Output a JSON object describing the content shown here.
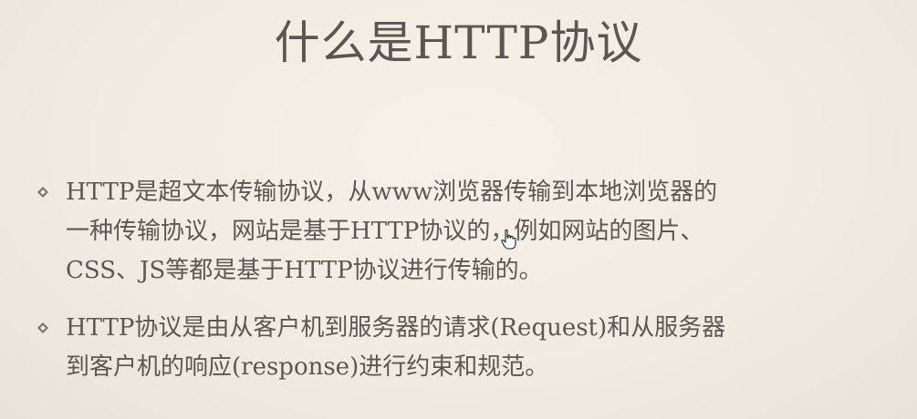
{
  "slide": {
    "title": "什么是HTTP协议",
    "bullets": [
      {
        "lines": [
          "HTTP是超文本传输协议，从www浏览器传输到本地浏览器的",
          "一种传输协议，网站是基于HTTP协议的，例如网站的图片、",
          "CSS、JS等都是基于HTTP协议进行传输的。"
        ],
        "marker_icon": "diamond-bullet-icon"
      },
      {
        "lines": [
          "HTTP协议是由从客户机到服务器的请求(Request)和从服务器",
          "到客户机的响应(response)进行约束和规范。"
        ],
        "marker_icon": "diamond-bullet-icon"
      }
    ]
  },
  "overlay": {
    "cursor_icon": "hand-pointer-icon"
  },
  "colors": {
    "background": "#efede1",
    "text": "#5a5652",
    "bullet": "#7a7570"
  }
}
